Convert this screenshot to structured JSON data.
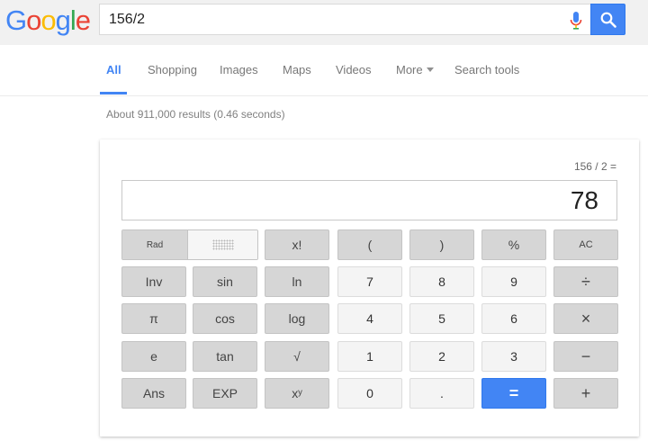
{
  "logo": {
    "letters": [
      "G",
      "o",
      "o",
      "g",
      "l",
      "e"
    ],
    "colors": [
      "#4285f4",
      "#ea4335",
      "#fbbc05",
      "#4285f4",
      "#34a853",
      "#ea4335"
    ]
  },
  "search": {
    "value": "156/2",
    "mic_icon": "microphone-icon",
    "button_icon": "search-icon"
  },
  "tabs": [
    "All",
    "Shopping",
    "Images",
    "Maps",
    "Videos",
    "More",
    "Search tools"
  ],
  "active_tab": "All",
  "result_stats": "About 911,000 results (0.46 seconds)",
  "calculator": {
    "expression": "156 / 2 =",
    "display": "78",
    "toggle": {
      "left": "Rad",
      "right_icon": "deg-dots"
    },
    "keys": {
      "fact": "x!",
      "lparen": "(",
      "rparen": ")",
      "percent": "%",
      "ac": "AC",
      "inv": "Inv",
      "sin": "sin",
      "ln": "ln",
      "n7": "7",
      "n8": "8",
      "n9": "9",
      "div": "÷",
      "pi": "π",
      "cos": "cos",
      "log": "log",
      "n4": "4",
      "n5": "5",
      "n6": "6",
      "mul": "×",
      "e": "e",
      "tan": "tan",
      "sqrt": "√",
      "n1": "1",
      "n2": "2",
      "n3": "3",
      "sub": "−",
      "ans": "Ans",
      "exp": "EXP",
      "pow": "xʸ",
      "n0": "0",
      "dot": ".",
      "eq": "=",
      "add": "+"
    }
  },
  "colors": {
    "accent": "#4285f4",
    "tab_inactive": "#777777",
    "key_gray": "#d6d6d6",
    "key_light": "#f4f4f4"
  }
}
